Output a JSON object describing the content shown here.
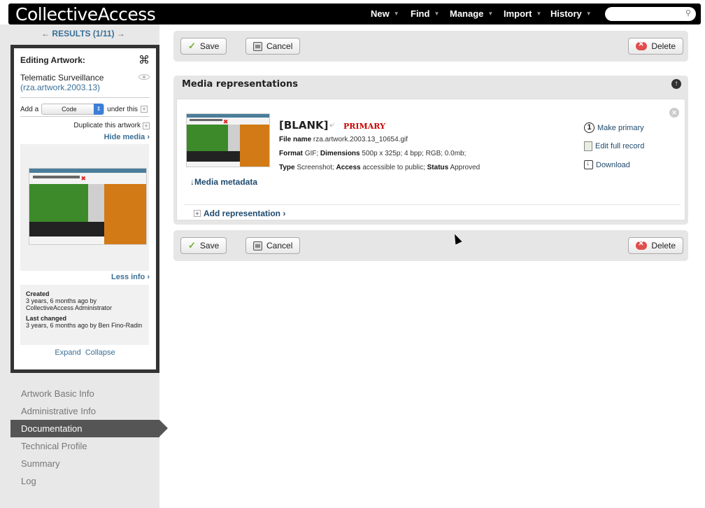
{
  "app": {
    "title": "CollectiveAccess"
  },
  "topnav": {
    "items": [
      "New",
      "Find",
      "Manage",
      "Import",
      "History"
    ],
    "search_placeholder": ""
  },
  "results": {
    "prev": "←",
    "label": "RESULTS (1/11)",
    "next": "→"
  },
  "inspector": {
    "title": "Editing Artwork:",
    "record_name": "Telematic Surveillance",
    "record_id": "(rza.artwork.2003.13)",
    "add_a": "Add a",
    "add_type": "Code",
    "under_this": "under this",
    "duplicate": "Duplicate this artwork",
    "hide_media": "Hide media ›",
    "less_info": "Less info ›",
    "created_label": "Created",
    "created_value": "3 years, 6 months ago by CollectiveAccess Administrator",
    "changed_label": "Last changed",
    "changed_value": "3 years, 6 months ago by Ben Fino-Radin",
    "expand": "Expand",
    "collapse": "Collapse"
  },
  "sidenav": {
    "items": [
      {
        "label": "Artwork Basic Info"
      },
      {
        "label": "Administrative Info"
      },
      {
        "label": "Documentation"
      },
      {
        "label": "Technical Profile"
      },
      {
        "label": "Summary"
      },
      {
        "label": "Log"
      }
    ],
    "active": "Documentation"
  },
  "toolbar": {
    "save": "Save",
    "cancel": "Cancel",
    "delete": "Delete"
  },
  "media": {
    "heading": "Media representations",
    "title": "[BLANK]",
    "primary": "PRIMARY",
    "file_name_label": "File name",
    "file_name": "rza.artwork.2003.13_10654.gif",
    "format_label": "Format",
    "format": "GIF;",
    "dimensions_label": "Dimensions",
    "dimensions": "500p x 325p; 4 bpp; RGB; 0.0mb;",
    "type_label": "Type",
    "type": "Screenshot;",
    "access_label": "Access",
    "access": "accessible to public;",
    "status_label": "Status",
    "status": "Approved",
    "media_metadata": "↓Media metadata",
    "make_primary": "Make primary",
    "edit_full_record": "Edit full record",
    "download": "Download",
    "add_representation": "Add representation ›"
  },
  "colors": {
    "link": "#3a6f96",
    "primary_badge": "#cc0000",
    "active_nav": "#555555"
  }
}
